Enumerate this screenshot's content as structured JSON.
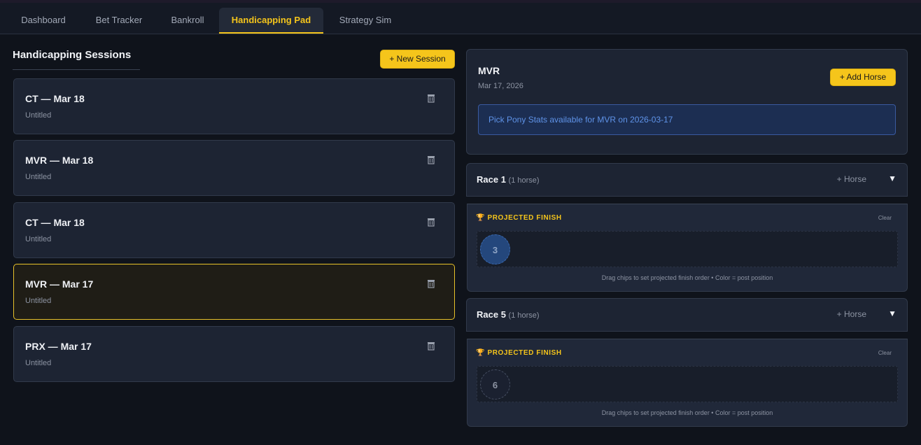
{
  "tabs": [
    "Dashboard",
    "Bet Tracker",
    "Bankroll",
    "Handicapping Pad",
    "Strategy Sim"
  ],
  "active_tab": "Handicapping Pad",
  "sessions_panel": {
    "heading": "Handicapping Sessions",
    "new_session_label": "+ New Session",
    "sessions": [
      {
        "title": "CT — Mar 18",
        "subtitle": "Untitled"
      },
      {
        "title": "MVR — Mar 18",
        "subtitle": "Untitled"
      },
      {
        "title": "CT — Mar 18",
        "subtitle": "Untitled"
      },
      {
        "title": "MVR — Mar 17",
        "subtitle": "Untitled",
        "selected": true
      },
      {
        "title": "PRX — Mar 17",
        "subtitle": "Untitled"
      }
    ]
  },
  "detail": {
    "venue": "MVR",
    "date": "Mar 17, 2026",
    "add_horse_label": "+ Add Horse",
    "stats_notice": "Pick Pony Stats available for MVR on 2026-03-17",
    "races": [
      {
        "name": "Race 1",
        "count": "(1 horse)",
        "add_label": "+ Horse",
        "caret": "▼",
        "projected_label": "PROJECTED FINISH",
        "clear_label": "Clear",
        "chips": [
          "3"
        ],
        "hint": "Drag chips to set projected finish order • Color = post position"
      },
      {
        "name": "Race 5",
        "count": "(1 horse)",
        "add_label": "+ Horse",
        "caret": "▼",
        "projected_label": "PROJECTED FINISH",
        "clear_label": "Clear",
        "chips": [
          "6"
        ],
        "hint": "Drag chips to set projected finish order • Color = post position"
      }
    ]
  },
  "colors": {
    "accent": "#f5c51b",
    "background": "#0f131b",
    "card": "#1d2433",
    "post_1_chip": "#24477c",
    "notice_text": "#5f93e8"
  }
}
